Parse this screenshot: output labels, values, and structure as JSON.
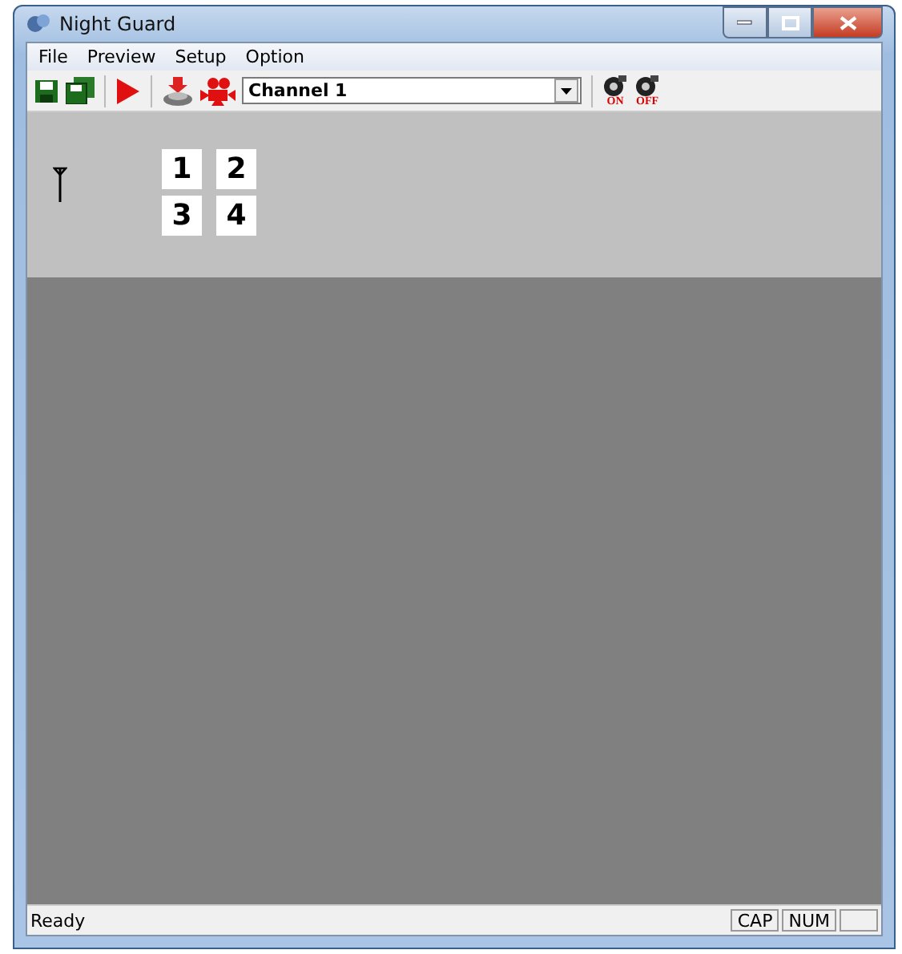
{
  "window": {
    "title": "Night Guard"
  },
  "menu": [
    "File",
    "Preview",
    "Setup",
    "Option"
  ],
  "toolbar": {
    "channel_select": {
      "value": "Channel 1"
    },
    "record_on_label": "ON",
    "record_off_label": "OFF"
  },
  "channels": [
    "1",
    "2",
    "3",
    "4"
  ],
  "status_bar": {
    "text": "Ready",
    "indicators": [
      "CAP",
      "NUM"
    ]
  }
}
